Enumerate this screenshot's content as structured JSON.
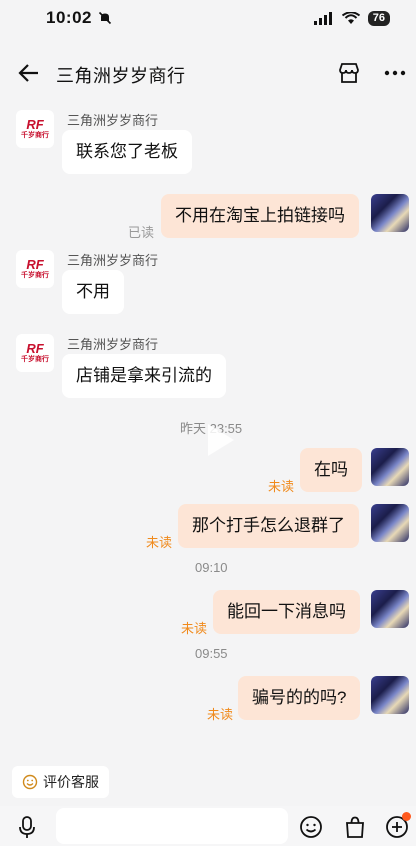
{
  "status": {
    "time": "10:02",
    "battery": "76"
  },
  "header": {
    "title": "三角洲岁岁商行"
  },
  "shop_logo": {
    "mark": "RF",
    "text": "千岁商行"
  },
  "messages": [
    {
      "sender": "三角洲岁岁商行",
      "text": "联系您了老板"
    },
    {
      "text": "不用在淘宝上拍链接吗",
      "status": "已读"
    },
    {
      "sender": "三角洲岁岁商行",
      "text": "不用"
    },
    {
      "sender": "三角洲岁岁商行",
      "text": "店铺是拿来引流的"
    },
    {
      "timestamp": "昨天 23:55"
    },
    {
      "text": "在吗",
      "status": "未读"
    },
    {
      "text": "那个打手怎么退群了",
      "status": "未读"
    },
    {
      "timestamp": "09:10"
    },
    {
      "text": "能回一下消息吗",
      "status": "未读"
    },
    {
      "timestamp": "09:55"
    },
    {
      "text": "骗号的的吗?",
      "status": "未读"
    }
  ],
  "footer": {
    "review_label": "评价客服",
    "input_placeholder": ""
  },
  "icons": {
    "back": "arrow-left-icon",
    "shop": "store-icon",
    "more": "more-dots-icon",
    "voice": "microphone-icon",
    "emoji": "emoji-icon",
    "bag": "shopping-bag-icon",
    "plus": "plus-circle-icon",
    "review": "smile-face-icon",
    "play": "play-icon"
  },
  "colors": {
    "accent_orange": "#f08a1c",
    "outgoing_bubble": "#fde5d6",
    "brand_red": "#c8102e"
  }
}
